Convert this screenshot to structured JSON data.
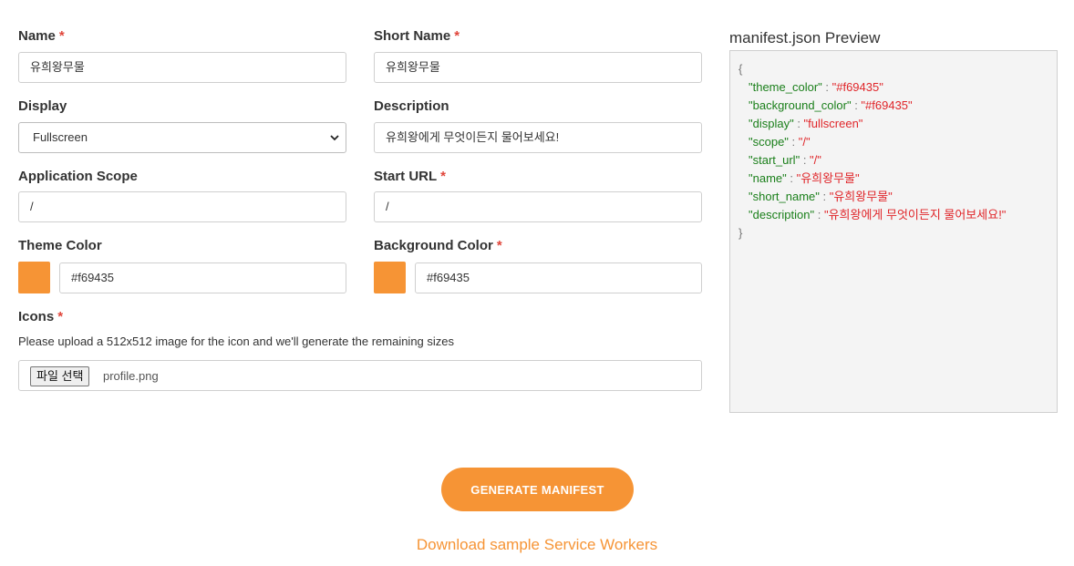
{
  "form": {
    "name": {
      "label": "Name",
      "value": "유희왕무물"
    },
    "short_name": {
      "label": "Short Name",
      "value": "유희왕무물"
    },
    "display": {
      "label": "Display",
      "value": "Fullscreen"
    },
    "description": {
      "label": "Description",
      "value": "유희왕에게 무엇이든지 물어보세요!"
    },
    "scope": {
      "label": "Application Scope",
      "value": "/"
    },
    "start_url": {
      "label": "Start URL",
      "value": "/"
    },
    "theme_color": {
      "label": "Theme Color",
      "value": "#f69435"
    },
    "background_color": {
      "label": "Background Color",
      "value": "#f69435"
    },
    "icons": {
      "label": "Icons",
      "hint": "Please upload a 512x512 image for the icon and we'll generate the remaining sizes",
      "button_label": "파일 선택",
      "file_name": "profile.png"
    },
    "required_mark": "*"
  },
  "preview": {
    "title": "manifest.json Preview",
    "open_brace": "{",
    "close_brace": "}",
    "sep": " : ",
    "lines": [
      {
        "key": "\"theme_color\"",
        "value": "\"#f69435\""
      },
      {
        "key": "\"background_color\"",
        "value": "\"#f69435\""
      },
      {
        "key": "\"display\"",
        "value": "\"fullscreen\""
      },
      {
        "key": "\"scope\"",
        "value": "\"/\""
      },
      {
        "key": "\"start_url\"",
        "value": "\"/\""
      },
      {
        "key": "\"name\"",
        "value": "\"유희왕무물\""
      },
      {
        "key": "\"short_name\"",
        "value": "\"유희왕무물\""
      },
      {
        "key": "\"description\"",
        "value": "\"유희왕에게 무엇이든지 물어보세요!\""
      }
    ]
  },
  "actions": {
    "generate_label": "GENERATE MANIFEST",
    "download_link": "Download sample Service Workers"
  },
  "colors": {
    "accent": "#f69435",
    "required": "#e0453a",
    "json_key": "#1a7f1a",
    "json_value": "#e0262a"
  }
}
